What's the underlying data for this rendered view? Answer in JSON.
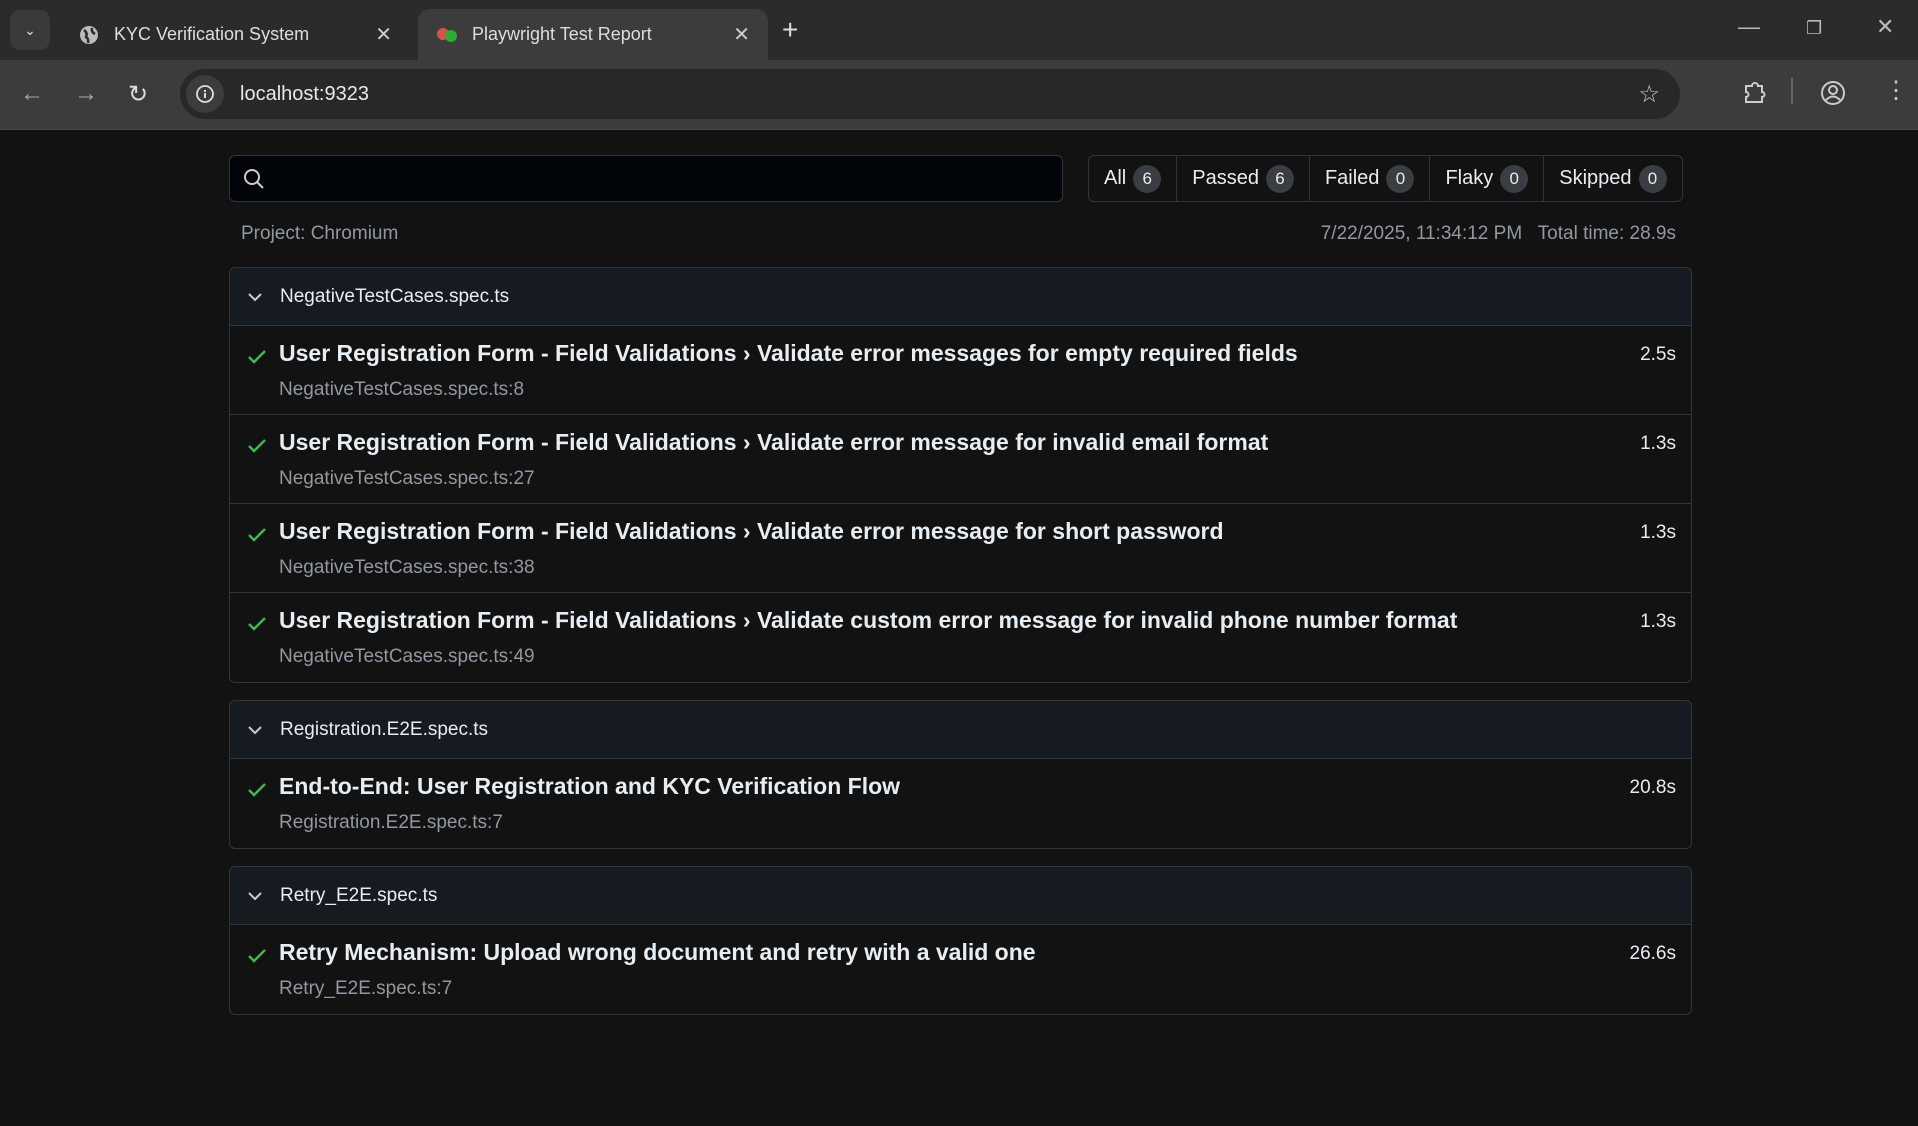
{
  "browser": {
    "tabs": [
      {
        "title": "KYC Verification System",
        "icon": "globe-icon",
        "active": false
      },
      {
        "title": "Playwright Test Report",
        "icon": "playwright-logo-icon",
        "active": true
      }
    ],
    "url": "localhost:9323"
  },
  "report": {
    "search": {
      "value": "",
      "placeholder": ""
    },
    "filters": [
      {
        "label": "All",
        "count": "6"
      },
      {
        "label": "Passed",
        "count": "6"
      },
      {
        "label": "Failed",
        "count": "0"
      },
      {
        "label": "Flaky",
        "count": "0"
      },
      {
        "label": "Skipped",
        "count": "0"
      }
    ],
    "project": "Project: Chromium",
    "timestamp": "7/22/2025, 11:34:12 PM",
    "total_time": "Total time: 28.9s",
    "colors": {
      "passed": "#3fb950"
    },
    "groups": [
      {
        "file": "NegativeTestCases.spec.ts",
        "tests": [
          {
            "title": "User Registration Form - Field Validations › Validate error messages for empty required fields",
            "location": "NegativeTestCases.spec.ts:8",
            "duration": "2.5s",
            "status": "passed"
          },
          {
            "title": "User Registration Form - Field Validations › Validate error message for invalid email format",
            "location": "NegativeTestCases.spec.ts:27",
            "duration": "1.3s",
            "status": "passed"
          },
          {
            "title": "User Registration Form - Field Validations › Validate error message for short password",
            "location": "NegativeTestCases.spec.ts:38",
            "duration": "1.3s",
            "status": "passed"
          },
          {
            "title": "User Registration Form - Field Validations › Validate custom error message for invalid phone number format",
            "location": "NegativeTestCases.spec.ts:49",
            "duration": "1.3s",
            "status": "passed"
          }
        ]
      },
      {
        "file": "Registration.E2E.spec.ts",
        "tests": [
          {
            "title": "End-to-End: User Registration and KYC Verification Flow",
            "location": "Registration.E2E.spec.ts:7",
            "duration": "20.8s",
            "status": "passed"
          }
        ]
      },
      {
        "file": "Retry_E2E.spec.ts",
        "tests": [
          {
            "title": "Retry Mechanism: Upload wrong document and retry with a valid one",
            "location": "Retry_E2E.spec.ts:7",
            "duration": "26.6s",
            "status": "passed"
          }
        ]
      }
    ]
  }
}
